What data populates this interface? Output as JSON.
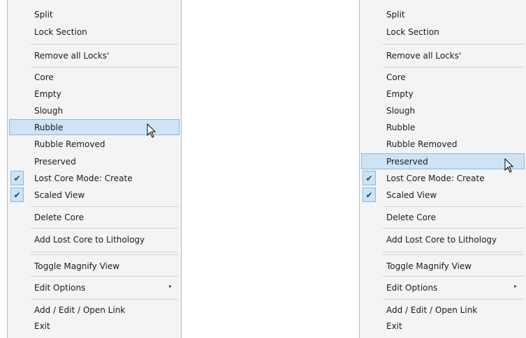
{
  "left_menu": {
    "split": "Split",
    "lock_section": "Lock Section",
    "remove_all_locks": "Remove all Locks'",
    "core": "Core",
    "empty": "Empty",
    "slough": "Slough",
    "rubble": "Rubble",
    "rubble_removed": "Rubble Removed",
    "preserved": "Preserved",
    "lost_core_mode": "Lost Core Mode: Create",
    "scaled_view": "Scaled View",
    "delete_core": "Delete Core",
    "add_lost_core": "Add Lost Core to Lithology",
    "toggle_magnify": "Toggle Magnify View",
    "edit_options": "Edit Options",
    "add_edit_open_link": "Add / Edit / Open Link",
    "exit": "Exit",
    "highlighted_item": "Rubble"
  },
  "right_menu": {
    "split": "Split",
    "lock_section": "Lock Section",
    "remove_all_locks": "Remove all Locks'",
    "core": "Core",
    "empty": "Empty",
    "slough": "Slough",
    "rubble": "Rubble",
    "rubble_removed": "Rubble Removed",
    "preserved": "Preserved",
    "lost_core_mode": "Lost Core Mode: Create",
    "scaled_view": "Scaled View",
    "delete_core": "Delete Core",
    "add_lost_core": "Add Lost Core to Lithology",
    "toggle_magnify": "Toggle Magnify View",
    "edit_options": "Edit Options",
    "add_edit_open_link": "Add / Edit / Open Link",
    "exit": "Exit",
    "highlighted_item": "Preserved"
  },
  "glyphs": {
    "check": "✔",
    "submenu_arrow": "▸"
  },
  "colors": {
    "hover_bg": "#cde4f7",
    "hover_border": "#88b8e0",
    "menu_bg": "#f4f4f4"
  }
}
